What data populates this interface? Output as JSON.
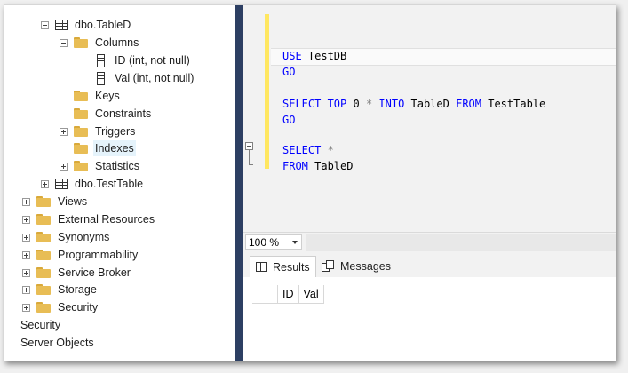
{
  "object_explorer": {
    "tree": [
      {
        "label": "dbo.TableD",
        "icon": "table-icon",
        "expander": "minus"
      },
      {
        "label": "Columns",
        "icon": "folder-icon",
        "expander": "minus"
      },
      {
        "label": "ID (int, not null)",
        "icon": "column-icon",
        "expander": "none"
      },
      {
        "label": "Val (int, not null)",
        "icon": "column-icon",
        "expander": "none"
      },
      {
        "label": "Keys",
        "icon": "folder-icon",
        "expander": "none"
      },
      {
        "label": "Constraints",
        "icon": "folder-icon",
        "expander": "none"
      },
      {
        "label": "Triggers",
        "icon": "folder-icon",
        "expander": "plus"
      },
      {
        "label": "Indexes",
        "icon": "folder-icon",
        "expander": "none",
        "selected": true
      },
      {
        "label": "Statistics",
        "icon": "folder-icon",
        "expander": "plus"
      },
      {
        "label": "dbo.TestTable",
        "icon": "table-icon",
        "expander": "plus"
      },
      {
        "label": "Views",
        "icon": "folder-icon",
        "expander": "plus"
      },
      {
        "label": "External Resources",
        "icon": "folder-icon",
        "expander": "plus"
      },
      {
        "label": "Synonyms",
        "icon": "folder-icon",
        "expander": "plus"
      },
      {
        "label": "Programmability",
        "icon": "folder-icon",
        "expander": "plus"
      },
      {
        "label": "Service Broker",
        "icon": "folder-icon",
        "expander": "plus"
      },
      {
        "label": "Storage",
        "icon": "folder-icon",
        "expander": "plus"
      },
      {
        "label": "Security",
        "icon": "folder-icon",
        "expander": "plus"
      },
      {
        "label": "Security",
        "icon": "none",
        "expander": "none"
      },
      {
        "label": "Server Objects",
        "icon": "none",
        "expander": "none"
      }
    ]
  },
  "editor": {
    "lines": {
      "l1_kw": "USE",
      "l1_tx": " TestDB",
      "l2_kw": "GO",
      "l3_kw1": "SELECT TOP",
      "l3_num": " 0 ",
      "l3_op": "*",
      "l3_kw2": " INTO",
      "l3_tx1": " TableD ",
      "l3_kw3": "FROM",
      "l3_tx2": " TestTable",
      "l4_kw": "GO",
      "l5_kw": "SELECT",
      "l5_op": " *",
      "l6_kw": "FROM",
      "l6_tx": " TableD"
    },
    "colors": {
      "keyword": "#0000ff",
      "operator": "#808080",
      "change_marker": "#ffe761"
    }
  },
  "zoom": {
    "value": "100 %"
  },
  "results": {
    "tabs": [
      {
        "label": "Results",
        "icon": "grid-icon"
      },
      {
        "label": "Messages",
        "icon": "messages-icon"
      }
    ],
    "columns": [
      "ID",
      "Val"
    ]
  },
  "colors": {
    "splitter": "#2d3f63",
    "selection": "#e5f3fb"
  }
}
